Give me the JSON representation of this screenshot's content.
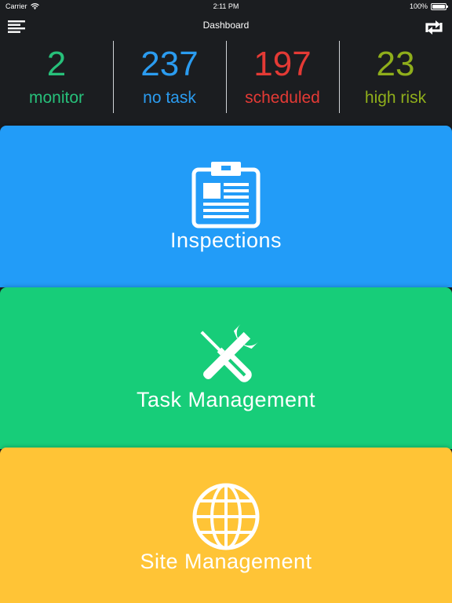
{
  "status_bar": {
    "carrier": "Carrier",
    "time": "2:11 PM",
    "battery": "100%",
    "battery_level": 1.0
  },
  "nav": {
    "title": "Dashboard",
    "left_icon": "menu-icon",
    "right_icon": "sync-icon"
  },
  "stats": [
    {
      "value": "2",
      "label": "monitor",
      "color": "#27c07a"
    },
    {
      "value": "237",
      "label": "no task",
      "color": "#2b9cf0"
    },
    {
      "value": "197",
      "label": "scheduled",
      "color": "#e43a35"
    },
    {
      "value": "23",
      "label": "high risk",
      "color": "#8fae1b"
    }
  ],
  "tiles": [
    {
      "label": "Inspections",
      "icon": "clipboard-icon",
      "color": "#229cf8"
    },
    {
      "label": "Task Management",
      "icon": "tools-icon",
      "color": "#17cd79"
    },
    {
      "label": "Site Management",
      "icon": "globe-icon",
      "color": "#ffc436"
    }
  ]
}
